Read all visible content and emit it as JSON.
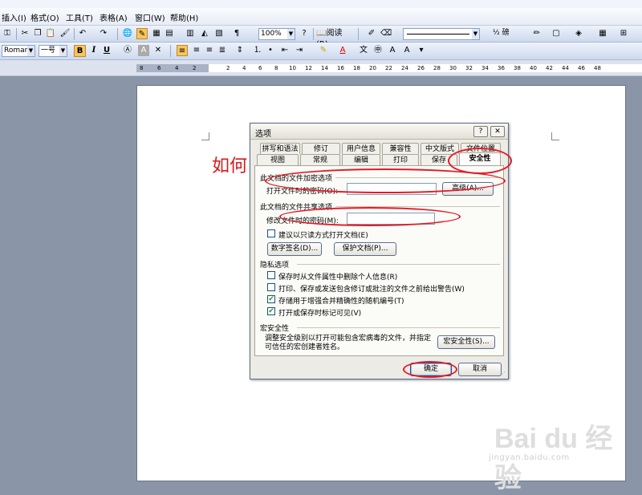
{
  "menu": {
    "items": [
      "插入(I)",
      "格式(O)",
      "工具(T)",
      "表格(A)",
      "窗口(W)",
      "帮助(H)"
    ]
  },
  "toolbar": {
    "zoom": "100%",
    "read_label": "阅读(R)",
    "line_weight": "½ 磅"
  },
  "format_toolbar": {
    "font_name": "Roman",
    "font_size": "一号",
    "bold": "B",
    "italic": "I",
    "underline": "U"
  },
  "ruler": {
    "ticks": [
      "8",
      "6",
      "4",
      "2",
      "2",
      "4",
      "6",
      "8",
      "10",
      "12",
      "14",
      "16",
      "18",
      "20",
      "22",
      "24",
      "26",
      "28",
      "30",
      "32",
      "34",
      "36",
      "38",
      "40",
      "42",
      "44",
      "46",
      "48"
    ]
  },
  "document": {
    "visible_text": "如何",
    "watermark_text": "Bai du 经验",
    "watermark_url": "jingyan.baidu.com"
  },
  "dialog": {
    "title": "选项",
    "help_btn": "?",
    "close_btn": "✕",
    "tabs_row1": [
      "拼写和语法",
      "修订",
      "用户信息",
      "兼容性",
      "中文版式",
      "文件位置"
    ],
    "tabs_row2": [
      "视图",
      "常规",
      "编辑",
      "打印",
      "保存",
      "安全性"
    ],
    "active_tab": "安全性",
    "section_encrypt": "此文档的文件加密选项",
    "open_password_label": "打开文件时的密码(O):",
    "open_password_value": "",
    "advanced_button": "高级(A)...",
    "section_share": "此文档的文件共享选项",
    "modify_password_label": "修改文件时的密码(M):",
    "modify_password_value": "",
    "readonly_recommend": "建议以只读方式打开文档(E)",
    "digital_sign_button": "数字签名(D)...",
    "protect_doc_button": "保护文档(P)...",
    "section_privacy": "隐私选项",
    "privacy_options": [
      {
        "label": "保存时从文件属性中删除个人信息(R)",
        "checked": false
      },
      {
        "label": "打印、保存或发送包含修订或批注的文件之前给出警告(W)",
        "checked": false
      },
      {
        "label": "存储用于增强合并精确性的随机编号(T)",
        "checked": true
      },
      {
        "label": "打开或保存时标记可见(V)",
        "checked": true
      }
    ],
    "section_macro": "宏安全性",
    "macro_desc": "调整安全级别以打开可能包含宏病毒的文件，并指定可信任的宏创建者姓名。",
    "macro_button": "宏安全性(S)...",
    "ok_button": "确定",
    "cancel_button": "取消"
  },
  "colors": {
    "annotation_red": "#e21b25",
    "doc_text_red": "#d7191c"
  }
}
